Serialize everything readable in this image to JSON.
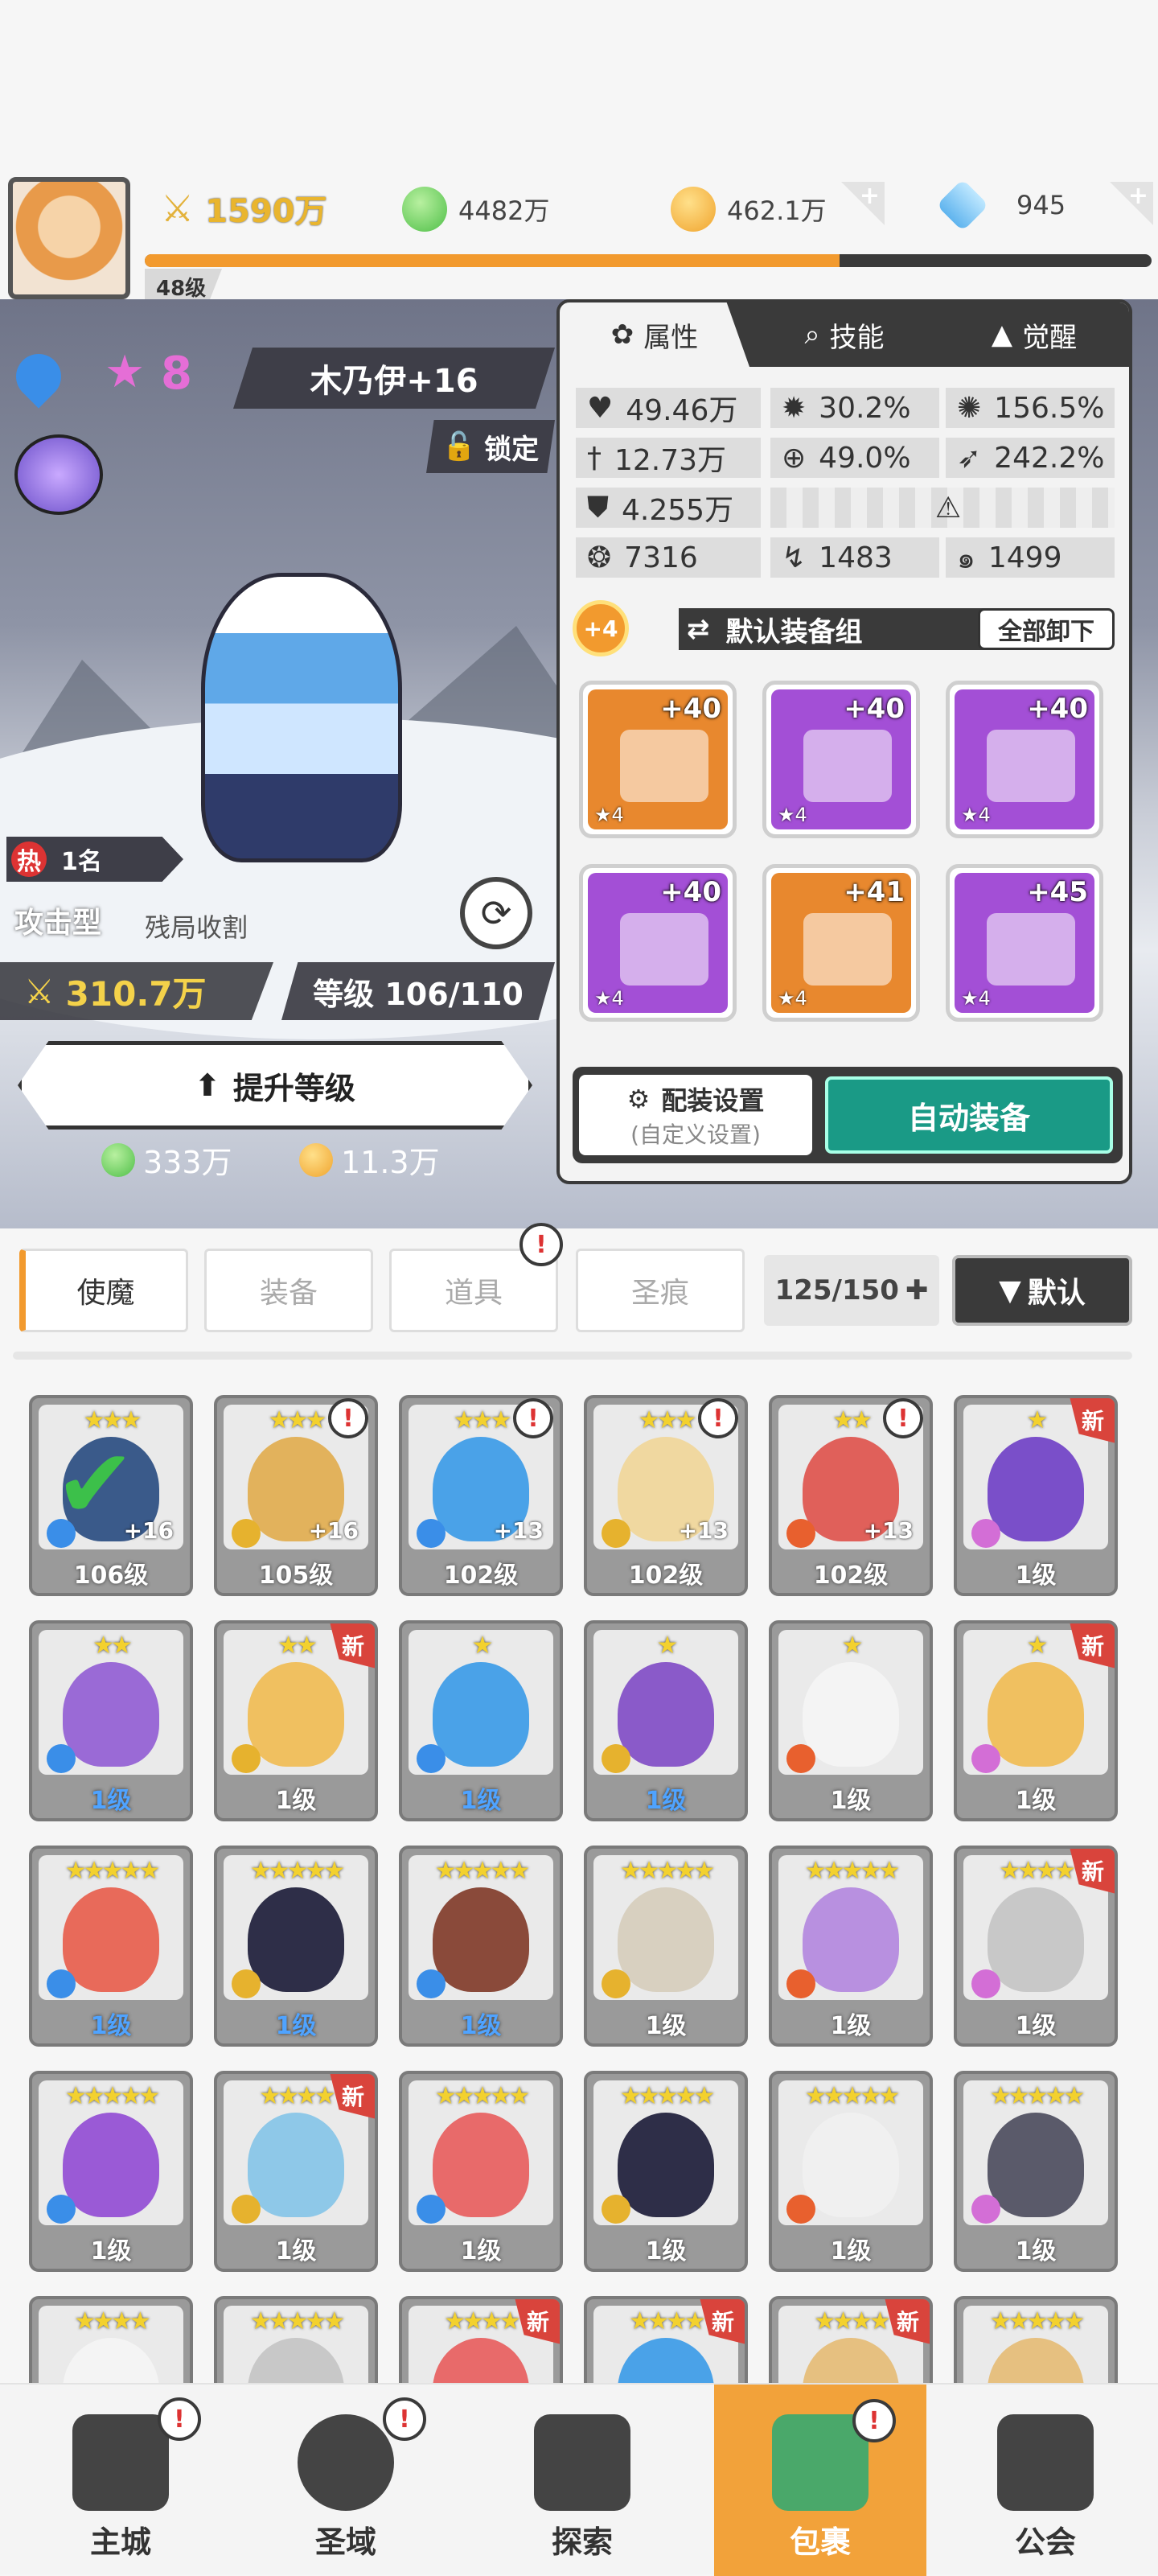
{
  "header": {
    "power": "1590万",
    "green_currency": "4482万",
    "gold_currency": "462.1万",
    "gem_currency": "945",
    "player_level": "48级",
    "xp_fraction": 0.69
  },
  "hero": {
    "star_count": "8",
    "name": "木乃伊+16",
    "lock_label": "锁定",
    "hot_label": "热",
    "rank": "1名",
    "type": "攻击型",
    "trait": "残局收割",
    "power": "310.7万",
    "level": "等级 106/110",
    "upgrade_label": "提升等级",
    "cost_green": "333万",
    "cost_gold": "11.3万"
  },
  "panel": {
    "tabs": [
      "属性",
      "技能",
      "觉醒"
    ],
    "stats": {
      "hp": "49.46万",
      "crit": "30.2%",
      "crit_dmg": "156.5%",
      "atk": "12.73万",
      "hit": "49.0%",
      "speed": "242.2%",
      "def": "4.255万",
      "s1": "7316",
      "s2": "1483",
      "s3": "1499"
    },
    "set_bonus": "+4",
    "equip_set": "默认装备组",
    "unequip_all": "全部卸下",
    "equips": [
      {
        "plus": "+40",
        "stars": "★4"
      },
      {
        "plus": "+40",
        "stars": "★4"
      },
      {
        "plus": "+40",
        "stars": "★4"
      },
      {
        "plus": "+40",
        "stars": "★4"
      },
      {
        "plus": "+41",
        "stars": "★4"
      },
      {
        "plus": "+45",
        "stars": "★4"
      }
    ],
    "config_label": "配装设置",
    "config_sub": "(自定义设置)",
    "auto_equip": "自动装备"
  },
  "filters": {
    "tabs": [
      "使魔",
      "装备",
      "道具",
      "圣痕"
    ],
    "count": "125/150",
    "sort": "默认"
  },
  "cards": [
    {
      "stars": "★★★",
      "level": "106级",
      "plus": "+16",
      "blue": false
    },
    {
      "stars": "★★★",
      "level": "105级",
      "plus": "+16",
      "blue": false
    },
    {
      "stars": "★★★",
      "level": "102级",
      "plus": "+13",
      "blue": false
    },
    {
      "stars": "★★★",
      "level": "102级",
      "plus": "+13",
      "blue": false
    },
    {
      "stars": "★★",
      "level": "102级",
      "plus": "+13",
      "blue": false
    },
    {
      "stars": "★",
      "level": "1级",
      "plus": "",
      "blue": false
    },
    {
      "stars": "★★",
      "level": "1级",
      "plus": "",
      "blue": true
    },
    {
      "stars": "★★",
      "level": "1级",
      "plus": "",
      "blue": false
    },
    {
      "stars": "★",
      "level": "1级",
      "plus": "",
      "blue": true
    },
    {
      "stars": "★",
      "level": "1级",
      "plus": "",
      "blue": true
    },
    {
      "stars": "★",
      "level": "1级",
      "plus": "",
      "blue": false
    },
    {
      "stars": "★",
      "level": "1级",
      "plus": "",
      "blue": false
    },
    {
      "stars": "★★★★★",
      "level": "1级",
      "plus": "",
      "blue": true
    },
    {
      "stars": "★★★★★",
      "level": "1级",
      "plus": "",
      "blue": true
    },
    {
      "stars": "★★★★★",
      "level": "1级",
      "plus": "",
      "blue": true
    },
    {
      "stars": "★★★★★",
      "level": "1级",
      "plus": "",
      "blue": false
    },
    {
      "stars": "★★★★★",
      "level": "1级",
      "plus": "",
      "blue": false
    },
    {
      "stars": "★★★★",
      "level": "1级",
      "plus": "",
      "blue": false
    },
    {
      "stars": "★★★★★",
      "level": "1级",
      "plus": "",
      "blue": false
    },
    {
      "stars": "★★★★",
      "level": "1级",
      "plus": "",
      "blue": false
    },
    {
      "stars": "★★★★★",
      "level": "1级",
      "plus": "",
      "blue": false
    },
    {
      "stars": "★★★★★",
      "level": "1级",
      "plus": "",
      "blue": false
    },
    {
      "stars": "★★★★★",
      "level": "1级",
      "plus": "",
      "blue": false
    },
    {
      "stars": "★★★★★",
      "level": "1级",
      "plus": "",
      "blue": false
    },
    {
      "stars": "★★★★",
      "level": "",
      "plus": "",
      "blue": false
    },
    {
      "stars": "★★★★★",
      "level": "",
      "plus": "",
      "blue": false
    },
    {
      "stars": "★★★★",
      "level": "",
      "plus": "",
      "blue": false
    },
    {
      "stars": "★★★★",
      "level": "",
      "plus": "",
      "blue": false
    },
    {
      "stars": "★★★★",
      "level": "",
      "plus": "",
      "blue": false
    },
    {
      "stars": "★★★★★",
      "level": "",
      "plus": "",
      "blue": false
    }
  ],
  "nav": [
    "主城",
    "圣域",
    "探索",
    "包裹",
    "公会"
  ],
  "colors": {
    "accent": "#f29a2e",
    "teal": "#1a9a86",
    "dark": "#3a3a3a"
  }
}
